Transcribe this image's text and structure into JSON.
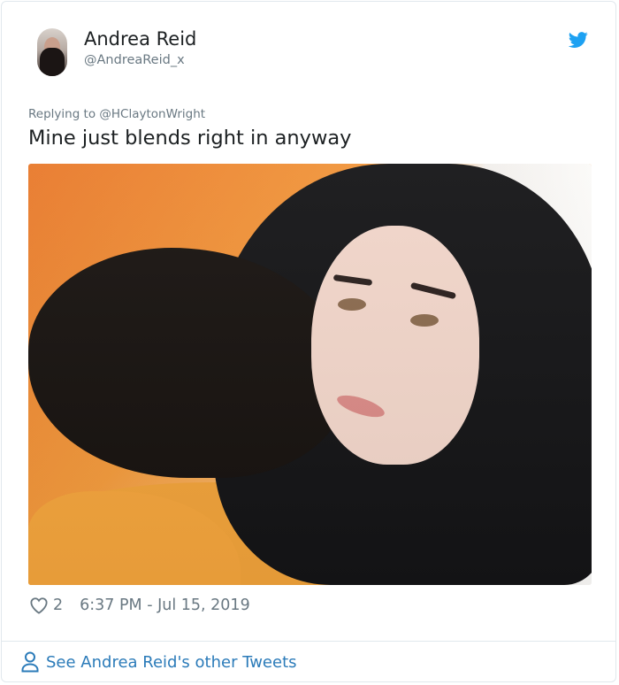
{
  "tweet": {
    "author_name": "Andrea Reid",
    "author_handle": "@AndreaReid_x",
    "reply_to": "Replying to @HClaytonWright",
    "text": "Mine just blends right in anyway",
    "likes": "2",
    "timestamp": "6:37 PM - Jul 15, 2019"
  },
  "footer": {
    "link_label": "See Andrea Reid's other Tweets"
  },
  "icons": {
    "brand": "twitter-bird-icon",
    "like": "heart-icon",
    "profile": "person-icon"
  },
  "colors": {
    "brand": "#1da1f2",
    "link": "#2b7bb9",
    "muted": "#697882",
    "text": "#1c2022",
    "border": "#e1e8ed"
  }
}
